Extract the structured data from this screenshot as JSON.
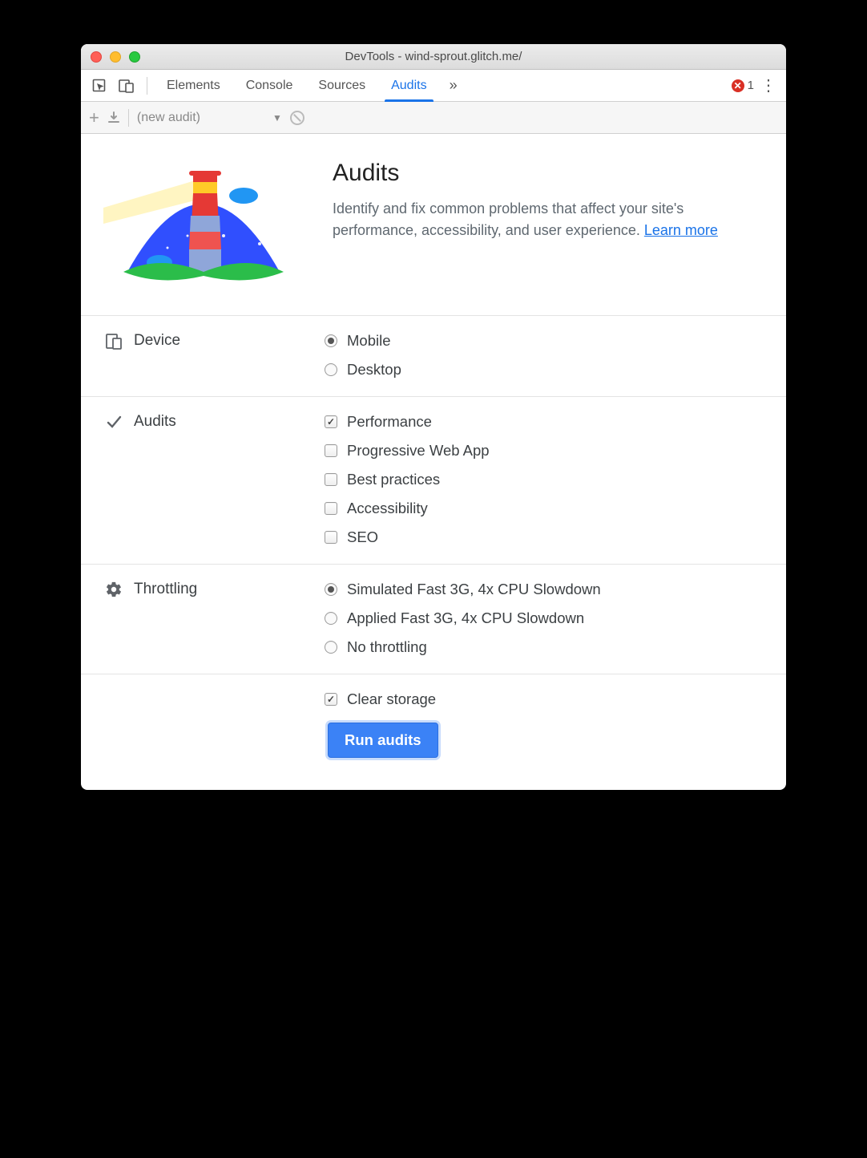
{
  "window": {
    "title": "DevTools - wind-sprout.glitch.me/"
  },
  "tabs": {
    "items": [
      "Elements",
      "Console",
      "Sources",
      "Audits"
    ],
    "active_index": 3,
    "error_count": "1"
  },
  "toolbar": {
    "audit_selector": "(new audit)"
  },
  "hero": {
    "heading": "Audits",
    "description": "Identify and fix common problems that affect your site's performance, accessibility, and user experience. ",
    "learn_more": "Learn more"
  },
  "sections": {
    "device": {
      "label": "Device",
      "options": [
        {
          "label": "Mobile",
          "checked": true
        },
        {
          "label": "Desktop",
          "checked": false
        }
      ]
    },
    "audits": {
      "label": "Audits",
      "options": [
        {
          "label": "Performance",
          "checked": true
        },
        {
          "label": "Progressive Web App",
          "checked": false
        },
        {
          "label": "Best practices",
          "checked": false
        },
        {
          "label": "Accessibility",
          "checked": false
        },
        {
          "label": "SEO",
          "checked": false
        }
      ]
    },
    "throttling": {
      "label": "Throttling",
      "options": [
        {
          "label": "Simulated Fast 3G, 4x CPU Slowdown",
          "checked": true
        },
        {
          "label": "Applied Fast 3G, 4x CPU Slowdown",
          "checked": false
        },
        {
          "label": "No throttling",
          "checked": false
        }
      ]
    },
    "clear_storage": {
      "label": "Clear storage",
      "checked": true
    }
  },
  "run_button": "Run audits"
}
